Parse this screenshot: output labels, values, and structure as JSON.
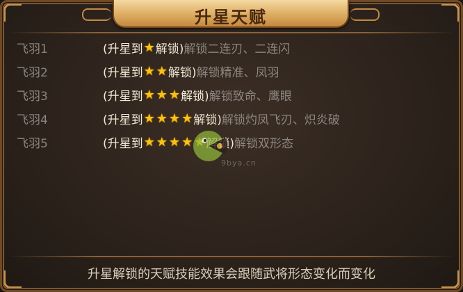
{
  "title": "升星天赋",
  "rows": [
    {
      "name": "飞羽1",
      "prefix": "(升星到",
      "stars": 1,
      "suffix": "解锁)",
      "desc": "解锁二连刃、二连闪"
    },
    {
      "name": "飞羽2",
      "prefix": "(升星到",
      "stars": 2,
      "suffix": "解锁)",
      "desc": "解锁精准、凤羽"
    },
    {
      "name": "飞羽3",
      "prefix": "(升星到",
      "stars": 3,
      "suffix": "解锁)",
      "desc": "解锁致命、鹰眼"
    },
    {
      "name": "飞羽4",
      "prefix": "(升星到",
      "stars": 4,
      "suffix": "解锁)",
      "desc": "解锁灼凤飞刃、炽炎破"
    },
    {
      "name": "飞羽5",
      "prefix": "(升星到",
      "stars": 5,
      "suffix": "解锁)",
      "desc": "解锁双形态"
    }
  ],
  "watermark": "9bya.cn",
  "footer": "升星解锁的天赋技能效果会跟随武将形态变化而变化",
  "colors": {
    "highlight": "#f3ead6",
    "dim": "#8d8680",
    "star": "#f6c21b",
    "frame": "#c69452"
  }
}
